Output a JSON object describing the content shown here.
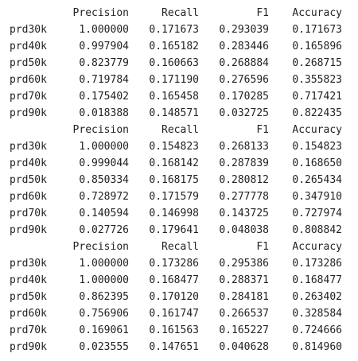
{
  "columns": [
    "Precision",
    "Recall",
    "F1",
    "Accuracy"
  ],
  "tables": [
    {
      "rows": [
        {
          "label": "prd30k",
          "values": [
            "1.000000",
            "0.171673",
            "0.293039",
            "0.171673"
          ]
        },
        {
          "label": "prd40k",
          "values": [
            "0.997904",
            "0.165182",
            "0.283446",
            "0.165896"
          ]
        },
        {
          "label": "prd50k",
          "values": [
            "0.823779",
            "0.160663",
            "0.268884",
            "0.268715"
          ]
        },
        {
          "label": "prd60k",
          "values": [
            "0.719784",
            "0.171190",
            "0.276596",
            "0.355823"
          ]
        },
        {
          "label": "prd70k",
          "values": [
            "0.175402",
            "0.165458",
            "0.170285",
            "0.717421"
          ]
        },
        {
          "label": "prd90k",
          "values": [
            "0.018388",
            "0.148571",
            "0.032725",
            "0.822435"
          ]
        }
      ]
    },
    {
      "rows": [
        {
          "label": "prd30k",
          "values": [
            "1.000000",
            "0.154823",
            "0.268133",
            "0.154823"
          ]
        },
        {
          "label": "prd40k",
          "values": [
            "0.999044",
            "0.168142",
            "0.287839",
            "0.168650"
          ]
        },
        {
          "label": "prd50k",
          "values": [
            "0.850334",
            "0.168175",
            "0.280812",
            "0.265434"
          ]
        },
        {
          "label": "prd60k",
          "values": [
            "0.728972",
            "0.171579",
            "0.277778",
            "0.347910"
          ]
        },
        {
          "label": "prd70k",
          "values": [
            "0.140594",
            "0.146998",
            "0.143725",
            "0.727974"
          ]
        },
        {
          "label": "prd90k",
          "values": [
            "0.027726",
            "0.179641",
            "0.048038",
            "0.808842"
          ]
        }
      ]
    },
    {
      "rows": [
        {
          "label": "prd30k",
          "values": [
            "1.000000",
            "0.173286",
            "0.295386",
            "0.173286"
          ]
        },
        {
          "label": "prd40k",
          "values": [
            "1.000000",
            "0.168477",
            "0.288371",
            "0.168477"
          ]
        },
        {
          "label": "prd50k",
          "values": [
            "0.862395",
            "0.170120",
            "0.284181",
            "0.263402"
          ]
        },
        {
          "label": "prd60k",
          "values": [
            "0.756906",
            "0.161747",
            "0.266537",
            "0.328584"
          ]
        },
        {
          "label": "prd70k",
          "values": [
            "0.169061",
            "0.161563",
            "0.165227",
            "0.724666"
          ]
        },
        {
          "label": "prd90k",
          "values": [
            "0.023555",
            "0.147651",
            "0.040628",
            "0.814960"
          ]
        }
      ]
    }
  ]
}
